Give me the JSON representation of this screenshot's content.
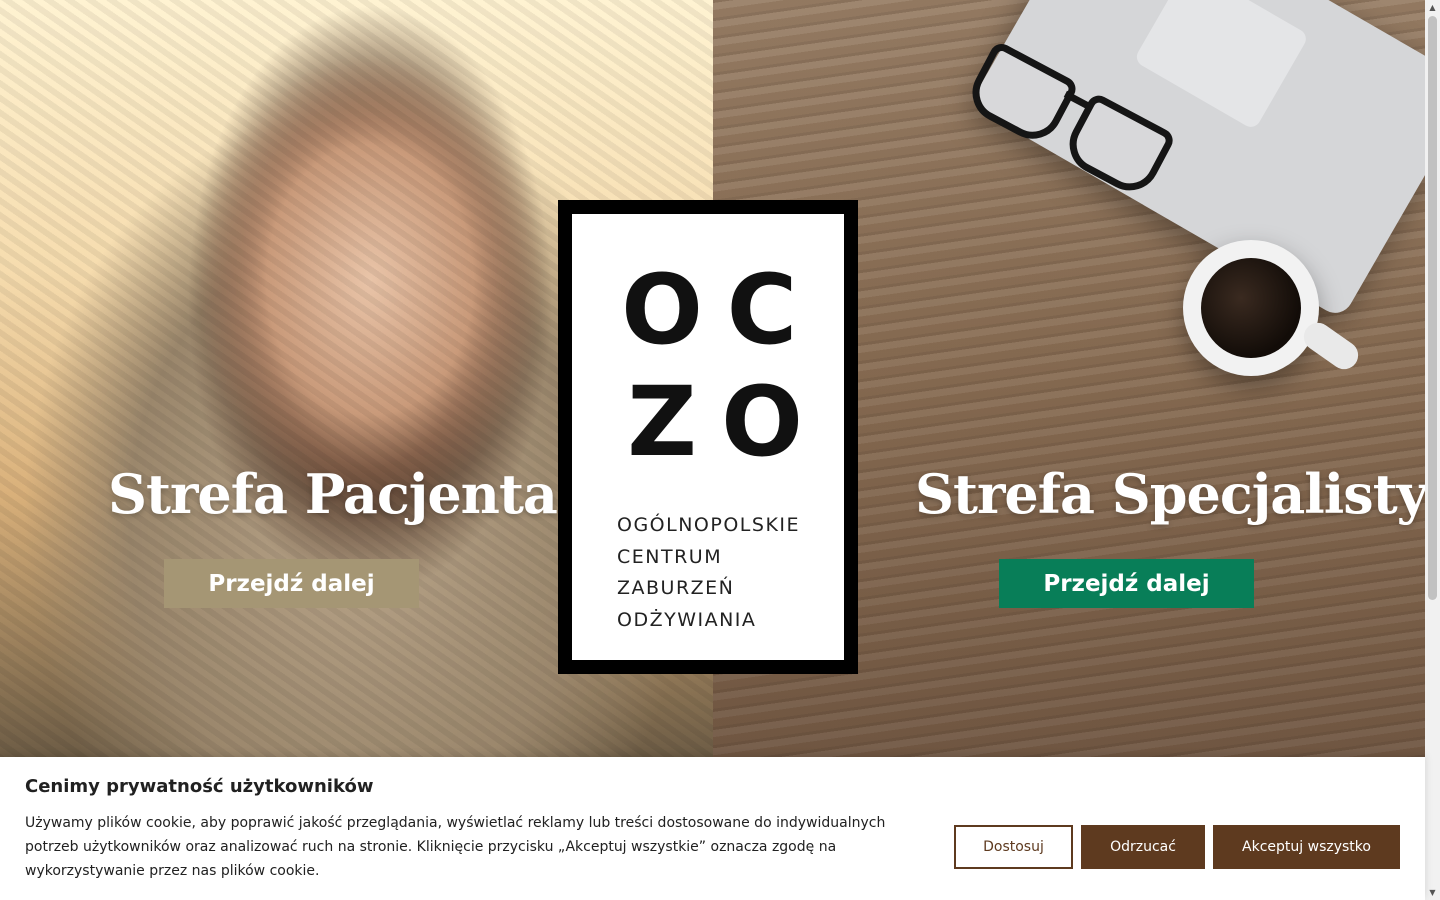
{
  "patient_zone": {
    "title": "Strefa Pacjenta",
    "button_label": "Przejdź dalej"
  },
  "specialist_zone": {
    "title": "Strefa Specjalisty",
    "button_label": "Przejdź dalej"
  },
  "logo": {
    "letters": [
      "O",
      "C",
      "Z",
      "O"
    ],
    "lines": [
      "OGÓLNOPOLSKIE",
      "CENTRUM",
      "ZABURZEŃ",
      "ODŻYWIANIA"
    ]
  },
  "cookie_banner": {
    "title": "Cenimy prywatność użytkowników",
    "text": "Używamy plików cookie, aby poprawić jakość przeglądania, wyświetlać reklamy lub treści dostosowane do indywidualnych potrzeb użytkowników oraz analizować ruch na stronie. Kliknięcie przycisku „Akceptuj wszystkie” oznacza zgodę na wykorzystywanie przez nas plików cookie.",
    "customize_label": "Dostosuj",
    "reject_label": "Odrzucać",
    "accept_label": "Akceptuj wszystko"
  },
  "colors": {
    "patient_button": "#a59674",
    "specialist_button": "#087e58",
    "cookie_accent": "#5e3a1f"
  },
  "icons": {
    "scroll_up": "arrow-up-icon",
    "scroll_down": "arrow-down-icon"
  }
}
